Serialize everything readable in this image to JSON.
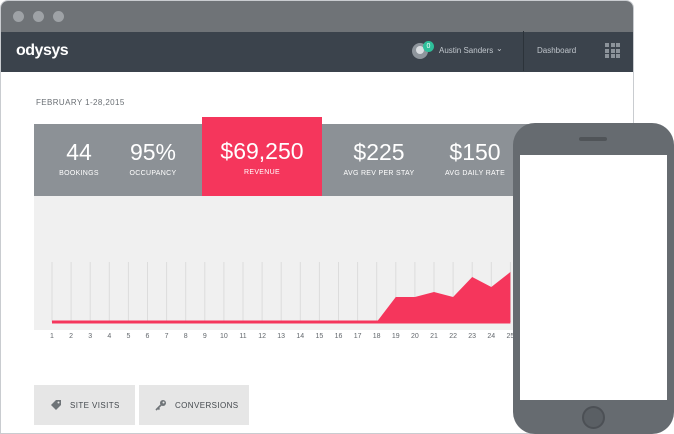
{
  "app": {
    "logo": "odysys"
  },
  "user": {
    "name": "Austin Sanders",
    "notifications": "0"
  },
  "nav": {
    "dashboard_label": "Dashboard"
  },
  "date_range": "FEBRUARY 1-28,2015",
  "stats": [
    {
      "value": "44",
      "label": "BOOKINGS"
    },
    {
      "value": "95%",
      "label": "OCCUPANCY"
    },
    {
      "value": "$69,250",
      "label": "REVENUE",
      "active": true
    },
    {
      "value": "$225",
      "label": "AVG REV PER STAY"
    },
    {
      "value": "$150",
      "label": "AVG DAILY RATE"
    }
  ],
  "chart_data": {
    "type": "area",
    "x": [
      1,
      2,
      3,
      4,
      5,
      6,
      7,
      8,
      9,
      10,
      11,
      12,
      13,
      14,
      15,
      16,
      17,
      18,
      19,
      20,
      21,
      22,
      23,
      24,
      25
    ],
    "values": [
      0,
      0,
      0,
      0,
      0,
      0,
      0,
      0,
      0,
      0,
      0,
      0,
      0,
      0,
      0,
      0,
      0,
      0,
      5,
      5,
      6,
      5,
      9,
      7,
      10
    ],
    "color": "#f5365c"
  },
  "tabs": [
    {
      "label": "SITE VISITS",
      "icon": "tag-icon"
    },
    {
      "label": "CONVERSIONS",
      "icon": "key-icon"
    }
  ],
  "colors": {
    "accent": "#f5365c",
    "stats_bg": "#8c9196",
    "appbar": "#3b434c"
  }
}
